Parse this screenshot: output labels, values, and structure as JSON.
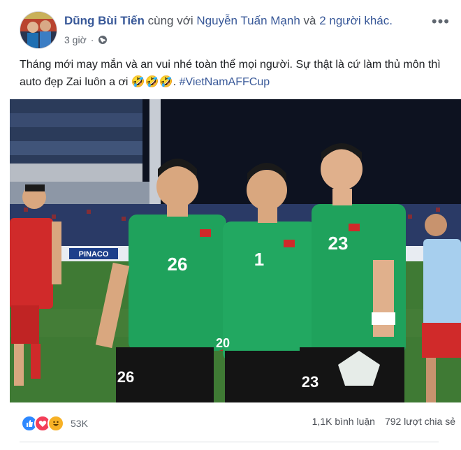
{
  "post": {
    "author": "Dũng Bùi Tiến",
    "with_text": "cùng với",
    "tagged_user": "Nguyễn Tuấn Mạnh",
    "and_text": "và",
    "others_link": "2 người khác.",
    "time": "3 giờ",
    "text": "Tháng mới may mắn và an vui nhé toàn thể mọi người. Sự thật là cứ làm thủ môn thì auto đẹp Zai luôn a ơi 🤣🤣🤣.",
    "hashtag": "#VietNamAFFCup",
    "more_glyph": "•••"
  },
  "photo": {
    "jersey_numbers": [
      "26",
      "1",
      "23"
    ],
    "shorts_numbers": [
      "26",
      "20",
      "23"
    ],
    "sponsor_board": "PINACO",
    "colors": {
      "kit_green": "#1fa25c",
      "kit_red": "#d02a2a",
      "pitch": "#3f7a34",
      "sky": "#0d1220"
    }
  },
  "footer": {
    "reaction_count": "53K",
    "comments": "1,1K bình luận",
    "shares": "792 lượt chia sẻ",
    "reaction_icons": [
      "like-icon",
      "love-icon",
      "haha-icon"
    ]
  }
}
